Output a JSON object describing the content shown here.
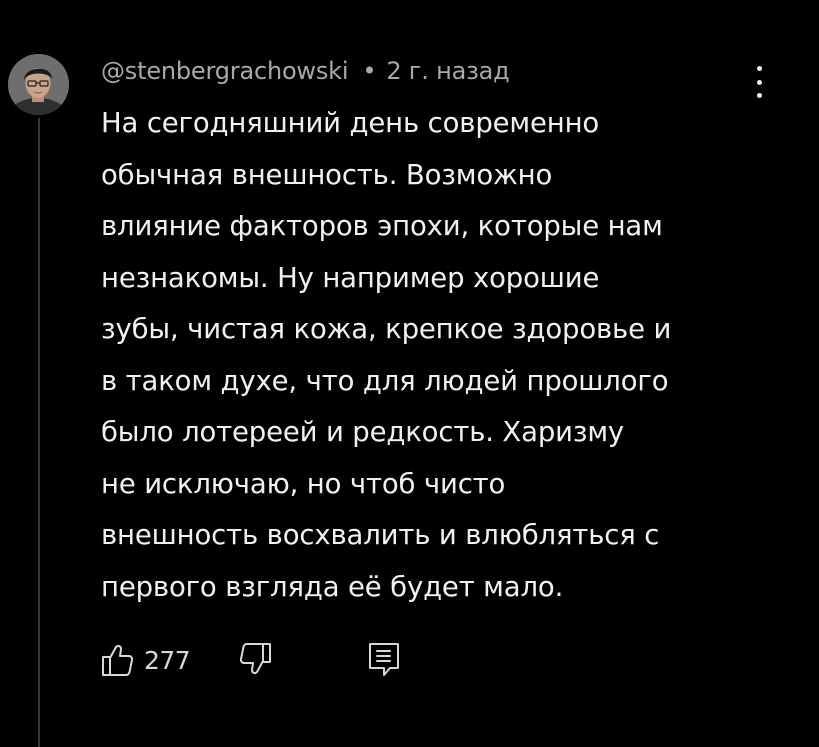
{
  "comment": {
    "author": "@stenbergrachowski",
    "separator": "•",
    "timestamp": "2 г. назад",
    "text": "На сегодняшний день современно\nобычная внешность. Возможно\nвлияние факторов эпохи, которые нам\nнезнакомы. Ну например хорошие\nзубы, чистая кожа, крепкое здоровье и\nв таком духе, что для людей прошлого\nбыло лотереей и редкость. Харизму\nне исключаю, но чтоб чисто\nвнешность восхвалить и влюбляться с\nпервого взгляда её будет мало.",
    "likes": "277"
  },
  "icons": {
    "avatar": "user-avatar-photo",
    "more": "more-vertical-icon",
    "like": "thumbs-up-icon",
    "dislike": "thumbs-down-icon",
    "reply": "comment-reply-icon"
  },
  "colors": {
    "background": "#000000",
    "text": "#f1f1f1",
    "meta": "#a9a9a9",
    "thread_line": "#3a3a3a"
  }
}
